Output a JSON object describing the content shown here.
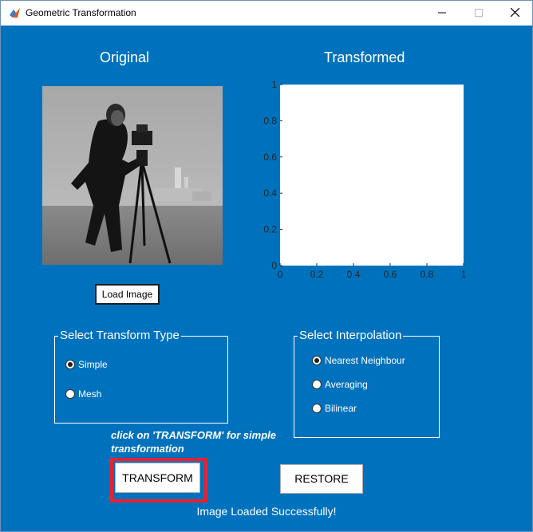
{
  "window": {
    "title": "Geometric Transformation",
    "minimize_icon": "minimize-icon",
    "maximize_icon": "maximize-icon",
    "close_icon": "close-icon"
  },
  "original": {
    "heading": "Original"
  },
  "transformed": {
    "heading": "Transformed"
  },
  "load_button": {
    "label": "Load Image"
  },
  "transform_type": {
    "title": "Select Transform Type",
    "options": [
      {
        "label": "Simple",
        "selected": true
      },
      {
        "label": "Mesh",
        "selected": false
      }
    ]
  },
  "interpolation": {
    "title": "Select Interpolation",
    "options": [
      {
        "label": "Nearest Neighbour",
        "selected": true
      },
      {
        "label": "Averaging",
        "selected": false
      },
      {
        "label": "Bilinear",
        "selected": false
      }
    ]
  },
  "hint": "click on 'TRANSFORM' for simple transformation",
  "transform_button": {
    "label": "TRANSFORM"
  },
  "restore_button": {
    "label": "RESTORE"
  },
  "status": "Image Loaded Successfully!",
  "axes": {
    "xticks": [
      "0",
      "0.2",
      "0.4",
      "0.6",
      "0.8",
      "1"
    ],
    "yticks": [
      "0",
      "0.2",
      "0.4",
      "0.6",
      "0.8",
      "1"
    ]
  },
  "colors": {
    "background": "#0072bd",
    "highlight": "#e8212f"
  }
}
